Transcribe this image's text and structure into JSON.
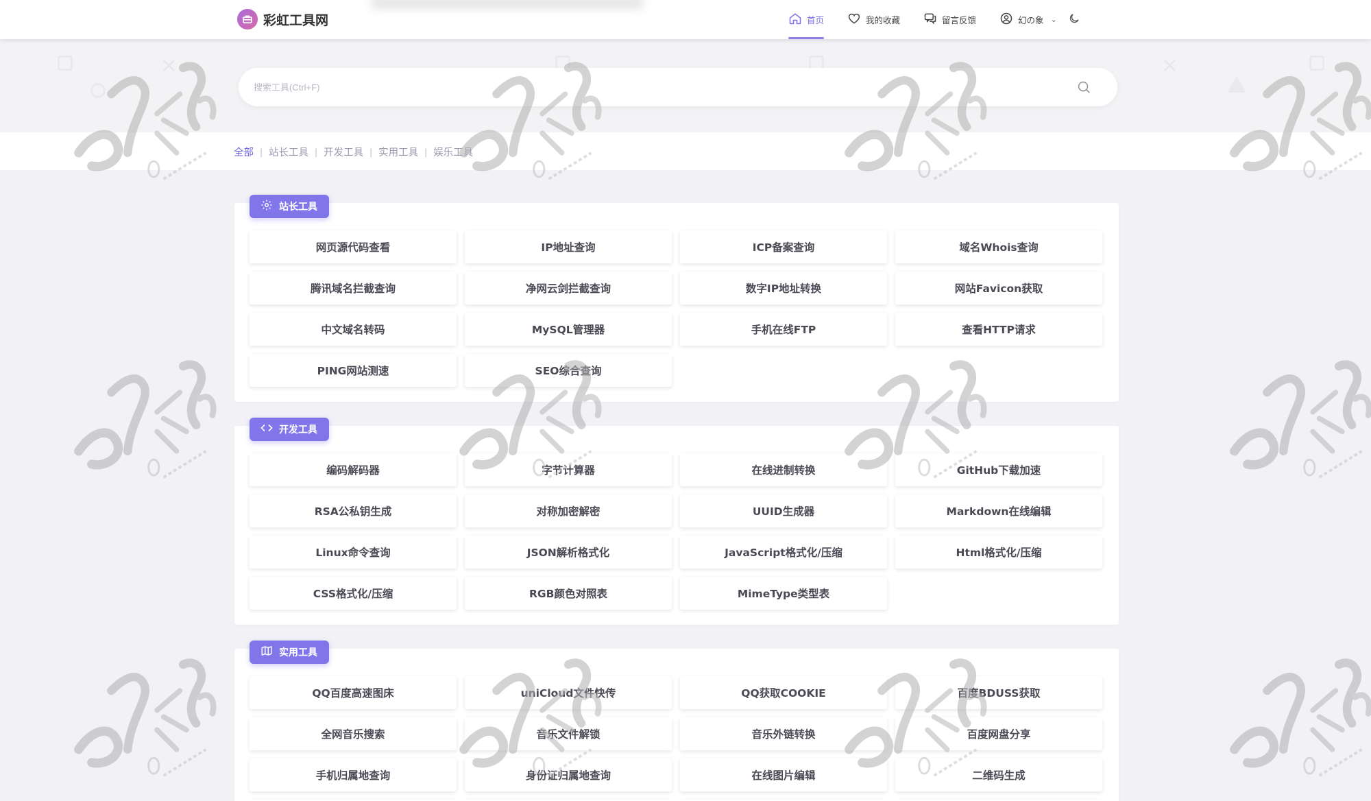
{
  "app": {
    "name": "彩虹工具网"
  },
  "nav": {
    "items": [
      {
        "label": "首页",
        "icon": "home-icon",
        "active": true
      },
      {
        "label": "我的收藏",
        "icon": "heart-icon",
        "active": false
      },
      {
        "label": "留言反馈",
        "icon": "chat-icon",
        "active": false
      },
      {
        "label": "幻の象",
        "icon": "user-circle-icon",
        "active": false
      }
    ],
    "theme_toggle_icon": "moon-icon"
  },
  "search": {
    "placeholder": "搜索工具(Ctrl+F)",
    "value": "",
    "icon": "search-icon"
  },
  "filters": [
    {
      "label": "全部",
      "active": true
    },
    {
      "label": "站长工具",
      "active": false
    },
    {
      "label": "开发工具",
      "active": false
    },
    {
      "label": "实用工具",
      "active": false
    },
    {
      "label": "娱乐工具",
      "active": false
    }
  ],
  "sections": [
    {
      "title": "站长工具",
      "icon": "gear-icon",
      "tools": [
        "网页源代码查看",
        "IP地址查询",
        "ICP备案查询",
        "域名Whois查询",
        "腾讯域名拦截查询",
        "净网云剑拦截查询",
        "数字IP地址转换",
        "网站Favicon获取",
        "中文域名转码",
        "MySQL管理器",
        "手机在线FTP",
        "查看HTTP请求",
        "PING网站测速",
        "SEO综合查询"
      ]
    },
    {
      "title": "开发工具",
      "icon": "code-icon",
      "tools": [
        "编码解码器",
        "字节计算器",
        "在线进制转换",
        "GitHub下载加速",
        "RSA公私钥生成",
        "对称加密解密",
        "UUID生成器",
        "Markdown在线编辑",
        "Linux命令查询",
        "JSON解析格式化",
        "JavaScript格式化/压缩",
        "Html格式化/压缩",
        "CSS格式化/压缩",
        "RGB颜色对照表",
        "MimeType类型表"
      ]
    },
    {
      "title": "实用工具",
      "icon": "map-icon",
      "tools": [
        "QQ百度高速图床",
        "uniCloud文件快传",
        "QQ获取COOKIE",
        "百度BDUSS获取",
        "全网音乐搜索",
        "音乐文件解锁",
        "音乐外链转换",
        "百度网盘分享",
        "手机归属地查询",
        "身份证归属地查询",
        "在线图片编辑",
        "二维码生成",
        "",
        "",
        "",
        ""
      ]
    }
  ],
  "colors": {
    "accent": "#8175ea",
    "accent_text": "#6f63e0",
    "background": "#f1f1f6"
  }
}
